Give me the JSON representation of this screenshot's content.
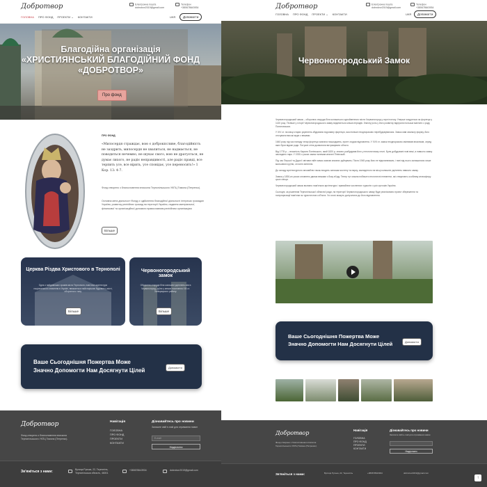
{
  "brand": {
    "logo": "Добротвор"
  },
  "left": {
    "contact": {
      "email": "dobrotvor2019@gmail.com",
      "email_label": "Електронна пошта",
      "phone_label": "Телефон",
      "phone": "+380678643934"
    },
    "nav": [
      "ГОЛОВНА",
      "ПРО ФОНД",
      "ПРОЕКТИ ⌄",
      "КОНТАКТИ"
    ],
    "lang": "UKR",
    "donate_label": "Допомогти",
    "hero_title": "Благодійна організація «ХРИСТИЯНСЬКИЙ БЛАГОДІЙНИЙ ФОНД «ДОБРОТВОР»",
    "hero_button": "Про фонд",
    "about": {
      "heading": "ПРО ФОНД",
      "quote": "«Милосердя страждає, вою є доброкпсливе, благодійність не заздрить, милосердя не хвалиться, не надмається, не поводиться нечемно, не шукає свого, вою не дратується, не думає лихого, не радіє неправдивості, але радіє правді, все терпить усе, все вірить, усе сповідає, усе переносить!» 1 Кор. 13: 4-7.",
      "p1": "Фонд створено з благословення єпископа Тернопільського УКПЦ Тимона (Петренко).",
      "p2": "Основна мета діяльності Фонду є здійснення благодійної діяльності інтересах громадян України, розвитку релігійних громад на території України, надання матеріальної, фінансової та організаційної допомоги православним релігійним організаціям",
      "more": "Більше"
    },
    "cards": [
      {
        "title": "Церква Різдва Христового в Тернополі",
        "text": "Одна з найдавніших храмів міста Тернополя, пам'ятка архітектури національного значення в Україні, вважається найстарішою будовою у місті, оборонного типу.",
        "button": "Більше"
      },
      {
        "title": "Червоногородський замок",
        "text": "Оборонна споруда біля колишніх укріплень міста Червоногород, руїни у межах поселення XIII ст. Заліщицького району.",
        "button": "Більше"
      }
    ],
    "donate_box": {
      "line1": "Ваше Сьогоднішня Пожертва Може",
      "line2": "Значно Допомогти Нам Досягнути Цілей",
      "button": "Допомогти"
    },
    "footer": {
      "desc": "Фонд створено з благословення єпископа Тернопільського УКПЦ Тимона (Петренко).",
      "nav_title": "Навігація",
      "nav": [
        "ГОЛОВНА",
        "ПРО ФОНД",
        "ПРОЕКТИ",
        "КОНТАКТИ"
      ],
      "news_title": "Дізнавайтесь про новини",
      "news_text": "Залиште свій e-mail для отримання новин",
      "email_placeholder": "E-mail",
      "subscribe": "Надіслати",
      "contact_title": "Зв'яжіться з нами:",
      "address": "Вулиця Руська, 22, Тернопіль, Тернопільська область, 46001",
      "phone": "+380678643934",
      "email": "dobrotvor2019@gmail.com"
    }
  },
  "right": {
    "hero_title": "Червоногородський Замок",
    "paragraphs": [
      "Червоногородський замок – оборонна споруда біля колишнього однойменного міста Червоногород у гирлі потоку. Уперше згадується як фортеця у 1140 році. Пізніше у історії Червоногородського замку виділяється кілька періодів. Значну роль у його розвитку відіграли польські магнати з роду Понятовських.",
      "У XIV ст. на місці старих укріплень збудовано муровану фортецю, яка пізніше неодноразово перебудовувалася. Замок мав овальну форму, його оточували високі мури з вежами.",
      "1640 року під час нападу татар фортеця зазнала пошкоджень, проте згодом відновлена. У XVII ст. замок неодноразово змінював власників, серед яких були відомі роди. Потужні стіни дозволяли витримувати облоги.",
      "Від 1778 р. – власність Кароля Понінського, який 1820 р. значно розбудував його у неоготичному стилі. Були добудовані нові вежі, а навколо замку закладено парк. У 1930-х роках замок належав княгині Пінінській.",
      "Під час Першої та Другої світових війн замок зазнав значних руйнувань. Після 1945 року його не відновлювали, і нині від нього залишилися лише мальовничі руїни, оточені зеленню.",
      "До складу архітектурного ансамблю також входять залишки костелу та парку, закладеного на місці колишніх укріплень навколо замку.",
      "Замок у 1830-их роках оновлено двома вежами з боку в'їзду. Тепер тут можна побачити неоготичні елементи, які створюють особливу атмосферу цього місця.",
      "Червоногородський замок визнано пам'яткою архітектури і приваблює численних туристів з усіх куточків України.",
      "Сьогодні, за рішенням Тернопільської обласної ради, на території Червоногородського замку буде реалізовано проект збереження та популяризації пам'ятки як туристичного об'єкта. Усі охочі можуть долучитися до його відновлення."
    ],
    "donate_box": {
      "line1": "Ваше Сьогоднішня Пожертва Може",
      "line2": "Значно Допомогти Нам Досягнути Цілей",
      "button": "Допомогти"
    },
    "footer": {
      "desc": "Фонд створено з благословення єпископа Тернопільського УКПЦ Тимона (Петренко).",
      "nav_title": "Навігація",
      "nav": [
        "ГОЛОВНА",
        "ПРО ФОНД",
        "ПРОЕКТИ",
        "КОНТАКТИ"
      ],
      "news_title": "Дізнавайтесь про новини",
      "news_text": "Залиште свій e-mail для отримання новин",
      "subscribe": "Надіслати",
      "contact_title": "Зв'яжіться з нами:",
      "address": "Вулиця Руська, 22, Тернопіль",
      "phone": "+380678643934",
      "email": "dobrotvor2019@gmail.com"
    }
  }
}
